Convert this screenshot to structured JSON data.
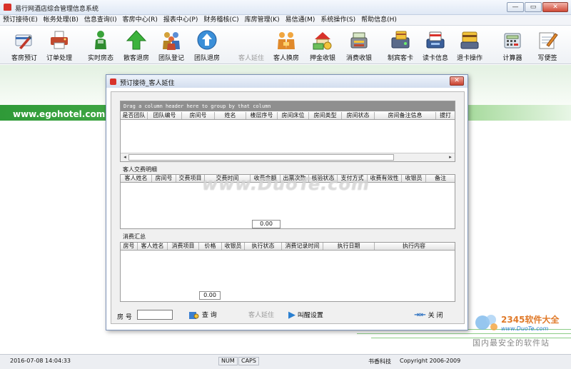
{
  "window": {
    "title": "易行网酒店综合管理信息系统",
    "buttons": [
      "—",
      "▭",
      "✕"
    ]
  },
  "menu": [
    "预订接待(E)",
    "帐务处理(B)",
    "信息查询(I)",
    "客房中心(R)",
    "报表中心(P)",
    "财务稽核(C)",
    "库房管理(K)",
    "易信通(M)",
    "系统操作(S)",
    "帮助信息(H)"
  ],
  "toolbar": [
    {
      "label": "客房预订",
      "icon": "card-sign-icon"
    },
    {
      "label": "订单处理",
      "icon": "printer-icon"
    },
    {
      "label": "实时房态",
      "icon": "person-green-icon"
    },
    {
      "label": "散客退房",
      "icon": "green-up-arrow-icon"
    },
    {
      "label": "团队登记",
      "icon": "group-people-icon"
    },
    {
      "label": "团队退房",
      "icon": "blue-up-arrow-icon"
    },
    {
      "label": "客人延住",
      "icon": "none",
      "disabled": true
    },
    {
      "label": "客人换房",
      "icon": "people-swap-icon"
    },
    {
      "label": "押金收银",
      "icon": "house-money-icon"
    },
    {
      "label": "消费收银",
      "icon": "cash-register-icon"
    },
    {
      "label": "制宾客卡",
      "icon": "card-maker-icon"
    },
    {
      "label": "读卡信息",
      "icon": "card-reader-icon"
    },
    {
      "label": "退卡操作",
      "icon": "card-return-icon"
    },
    {
      "label": "计算器",
      "icon": "calculator-icon"
    },
    {
      "label": "写便签",
      "icon": "notepad-icon"
    }
  ],
  "banner": {
    "text": "www.egohotel.com  易"
  },
  "dialog": {
    "title": "预订接待_客人延住",
    "group_hint": "Drag a column header here to group by that column",
    "grid1_columns": [
      "是否团队",
      "团队编号",
      "房间号",
      "姓名",
      "楼层序号",
      "房间床位",
      "房间类型",
      "房间状态",
      "房间备注信息",
      "拔打"
    ],
    "section2": "客人交费明细",
    "grid2_columns": [
      "客人姓名",
      "房间号",
      "交费项目",
      "交费时间",
      "收费金额",
      "出票次数",
      "核验状态",
      "支付方式",
      "收费有效性",
      "收银员",
      "备注"
    ],
    "grid2_total": "0.00",
    "section3": "消费汇总",
    "grid3_columns": [
      "房号",
      "客人姓名",
      "消费项目",
      "价格",
      "收银员",
      "执行状态",
      "消费记录时间",
      "执行日期",
      "执行内容"
    ],
    "grid3_total": "0.00",
    "room_label": "房 号",
    "room_value": "",
    "query_label": "查 询",
    "extend_label": "客人延住",
    "reminder_label": "叫醒设置",
    "close_label": "关 闭"
  },
  "watermark": {
    "center": "www.DuoTe.com",
    "brand": "2345软件大全",
    "brand_url": "www.DuoTe.com",
    "slogan": "国内最安全的软件站"
  },
  "status": {
    "datetime": "2016-07-08 14:04:33",
    "num": "NUM",
    "caps": "CAPS",
    "company": "书香科技",
    "copyright": "Copyright 2006-2009"
  },
  "colors": {
    "accent_green": "#54b552",
    "title_red": "#d8322b"
  }
}
